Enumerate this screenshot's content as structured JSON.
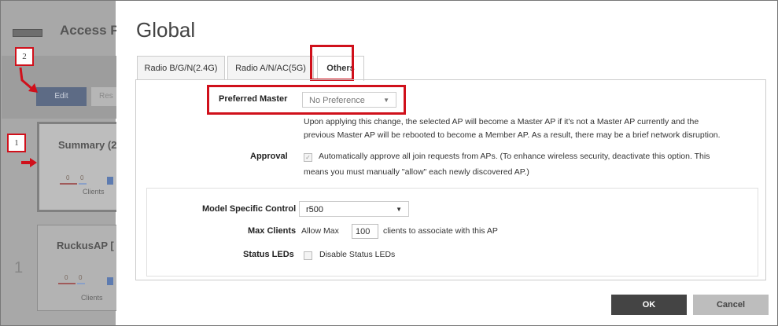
{
  "background": {
    "page_title": "Access P",
    "edit_label": "Edit",
    "res_label": "Res",
    "cards": [
      {
        "title": "Summary (2",
        "clients_label": "Clients",
        "counts": [
          "0",
          "0"
        ]
      },
      {
        "title": "RuckusAP [",
        "clients_label": "Clients",
        "counts": [
          "0",
          "0"
        ]
      }
    ],
    "row_number": "1"
  },
  "annotations": {
    "badge_2": "2",
    "badge_1": "1",
    "highlight_color": "#d0101b"
  },
  "dialog": {
    "title": "Global",
    "tabs": [
      {
        "label": "Radio B/G/N(2.4G)",
        "active": false
      },
      {
        "label": "Radio A/N/AC(5G)",
        "active": false
      },
      {
        "label": "Others",
        "active": true
      }
    ],
    "preferred_master": {
      "label": "Preferred Master",
      "value": "No Preference",
      "note_line1": "Upon applying this change, the selected AP will become a Master AP if it's not a Master AP currently and the",
      "note_line2": "previous Master AP will be rebooted to become a Member AP. As a result, there may be a brief network disruption."
    },
    "approval": {
      "label": "Approval",
      "checked": true,
      "text_line1": "Automatically approve all join requests from APs. (To enhance wireless security, deactivate this option. This",
      "text_line2": "means you must manually \"allow\" each newly discovered AP.)"
    },
    "model_specific_control": {
      "label": "Model Specific Control",
      "value": "r500"
    },
    "max_clients": {
      "label": "Max Clients",
      "prefix": "Allow Max",
      "value": "100",
      "suffix": "clients to associate with this AP"
    },
    "status_leds": {
      "label": "Status LEDs",
      "checkbox_label": "Disable Status LEDs",
      "checked": false
    },
    "ok_label": "OK",
    "cancel_label": "Cancel"
  }
}
